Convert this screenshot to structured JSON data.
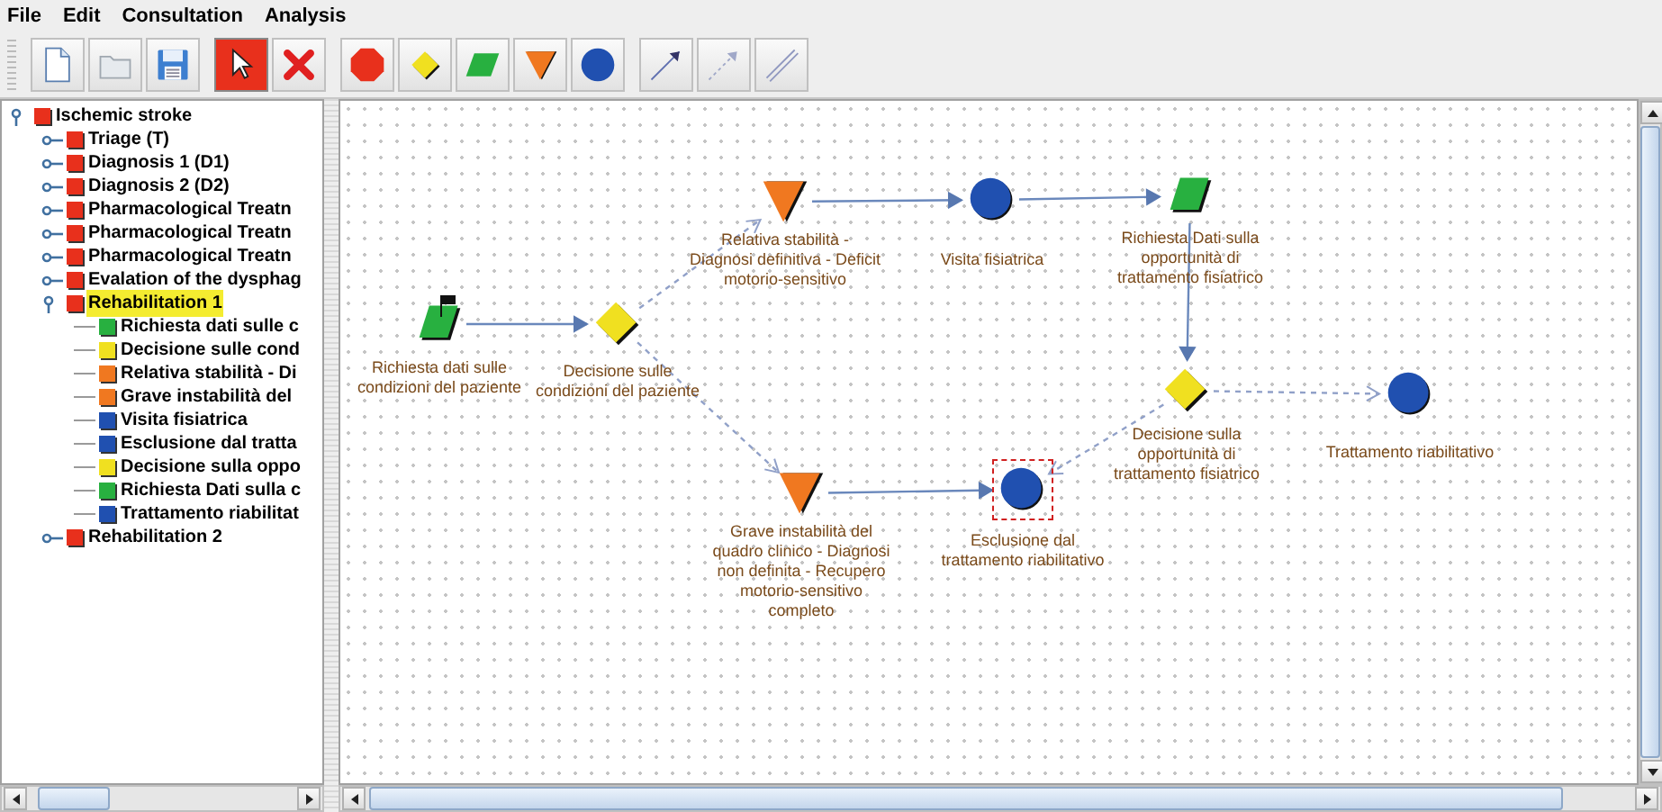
{
  "menu": [
    "File",
    "Edit",
    "Consultation",
    "Analysis"
  ],
  "toolbar_groups": [
    [
      {
        "kind": "new",
        "selected": false
      },
      {
        "kind": "open",
        "selected": false
      },
      {
        "kind": "save",
        "selected": false
      }
    ],
    [
      {
        "kind": "select",
        "selected": true
      },
      {
        "kind": "delete",
        "selected": false
      }
    ],
    [
      {
        "kind": "octagon",
        "selected": false
      },
      {
        "kind": "diamond",
        "selected": false
      },
      {
        "kind": "parallelogram",
        "selected": false
      },
      {
        "kind": "triangle",
        "selected": false
      },
      {
        "kind": "circle",
        "selected": false
      }
    ],
    [
      {
        "kind": "arrow",
        "selected": false
      },
      {
        "kind": "dashed-arrow",
        "selected": false
      },
      {
        "kind": "line",
        "selected": false
      }
    ]
  ],
  "tree": [
    {
      "label": "Ischemic stroke",
      "color": "#e8301c",
      "expanded": true,
      "selected": false,
      "children": [
        {
          "label": "Triage (T)",
          "color": "#e8301c",
          "expanded": false,
          "selected": false
        },
        {
          "label": "Diagnosis 1 (D1)",
          "color": "#e8301c",
          "expanded": false,
          "selected": false
        },
        {
          "label": "Diagnosis 2 (D2)",
          "color": "#e8301c",
          "expanded": false,
          "selected": false
        },
        {
          "label": "Pharmacological Treatn",
          "color": "#e8301c",
          "expanded": false,
          "selected": false
        },
        {
          "label": "Pharmacological Treatn",
          "color": "#e8301c",
          "expanded": false,
          "selected": false
        },
        {
          "label": "Pharmacological Treatn",
          "color": "#e8301c",
          "expanded": false,
          "selected": false
        },
        {
          "label": "Evalation of the dysphag",
          "color": "#e8301c",
          "expanded": false,
          "selected": false
        },
        {
          "label": "Rehabilitation 1",
          "color": "#e8301c",
          "expanded": true,
          "selected": true,
          "children": [
            {
              "label": "Richiesta dati sulle c",
              "color": "#28b040",
              "selected": false
            },
            {
              "label": "Decisione sulle cond",
              "color": "#f0e020",
              "selected": false
            },
            {
              "label": "Relativa stabilità - Di",
              "color": "#f07820",
              "selected": false
            },
            {
              "label": "Grave instabilità del",
              "color": "#f07820",
              "selected": false
            },
            {
              "label": "Visita fisiatrica",
              "color": "#2050b0",
              "selected": false
            },
            {
              "label": "Esclusione dal tratta",
              "color": "#2050b0",
              "selected": false
            },
            {
              "label": "Decisione sulla oppo",
              "color": "#f0e020",
              "selected": false
            },
            {
              "label": "Richiesta Dati sulla c",
              "color": "#28b040",
              "selected": false
            },
            {
              "label": "Trattamento riabilitat",
              "color": "#2050b0",
              "selected": false
            }
          ]
        },
        {
          "label": "Rehabilitation 2",
          "color": "#e8301c",
          "expanded": false,
          "selected": false
        }
      ]
    }
  ],
  "diagram": {
    "nodes": [
      {
        "kind": "parallelogram",
        "label": "Richiesta dati sulle condizioni del paziente",
        "start": true,
        "selected": false
      },
      {
        "kind": "diamond",
        "label": "Decisione sulle condizioni del paziente",
        "start": false,
        "selected": false
      },
      {
        "kind": "triangle",
        "label": "Relativa stabilità - Diagnosi definitiva - Deficit motorio-sensitivo",
        "start": false,
        "selected": false
      },
      {
        "kind": "circle",
        "label": "Visita fisiatrica",
        "start": false,
        "selected": false
      },
      {
        "kind": "parallelogram",
        "label": "Richiesta Dati sulla opportunità di trattamento fisiatrico",
        "start": false,
        "selected": false
      },
      {
        "kind": "diamond",
        "label": "Decisione sulla opportunità di trattamento fisiatrico",
        "start": false,
        "selected": false
      },
      {
        "kind": "circle",
        "label": "Trattamento riabilitativo",
        "start": false,
        "selected": false
      },
      {
        "kind": "triangle",
        "label": "Grave instabilità del quadro clinico - Diagnosi non definita - Recupero motorio-sensitivo completo",
        "start": false,
        "selected": false
      },
      {
        "kind": "circle",
        "label": "Esclusione dal trattamento riabilitativo",
        "start": false,
        "selected": true
      }
    ],
    "edges": [
      {
        "dashed": false
      },
      {
        "dashed": true
      },
      {
        "dashed": true
      },
      {
        "dashed": false
      },
      {
        "dashed": false
      },
      {
        "dashed": false
      },
      {
        "dashed": true
      },
      {
        "dashed": true
      },
      {
        "dashed": false
      }
    ]
  }
}
